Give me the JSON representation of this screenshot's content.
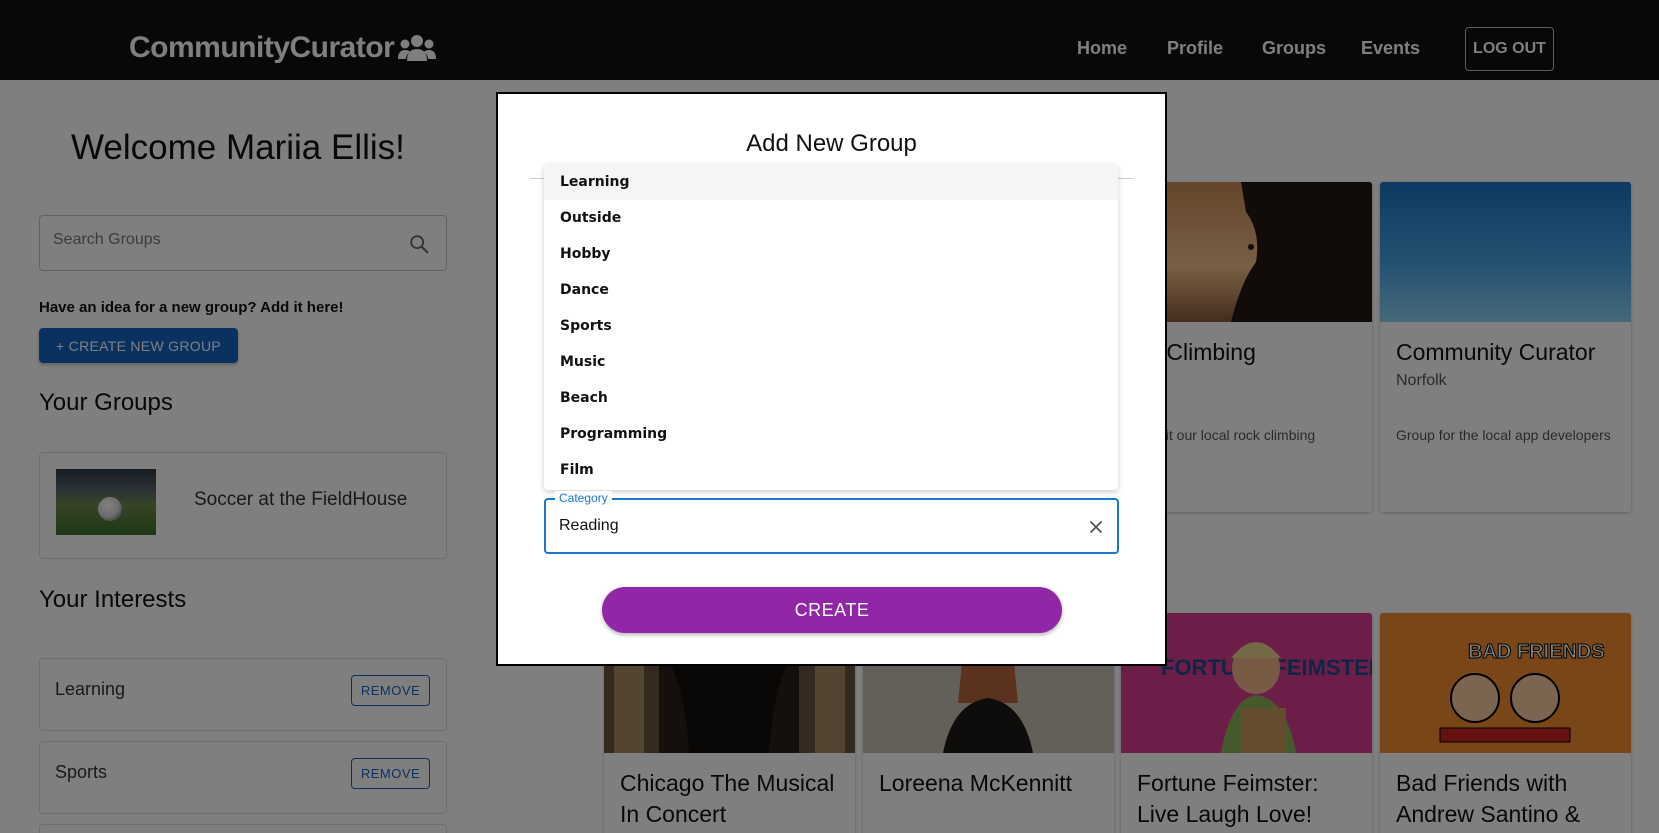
{
  "navbar": {
    "brand": "CommunityCurator",
    "links": [
      "Home",
      "Profile",
      "Groups",
      "Events"
    ],
    "logout_label": "LOG OUT"
  },
  "sidebar": {
    "welcome": "Welcome Mariia Ellis!",
    "search_placeholder": "Search Groups",
    "idea_text": "Have an idea for a new group? Add it here!",
    "create_button": "+ CREATE NEW GROUP",
    "your_groups_title": "Your Groups",
    "groups": [
      {
        "name": "Soccer at the FieldHouse"
      }
    ],
    "your_interests_title": "Your Interests",
    "interests": [
      {
        "name": "Learning",
        "action": "REMOVE"
      },
      {
        "name": "Sports",
        "action": "REMOVE"
      }
    ]
  },
  "main": {
    "top_cards": [
      {
        "title": "Rock Climbing",
        "visible_title": "ck Climbing",
        "location": "Norfolk",
        "visible_location": "folk",
        "description": "e visit our local rock climbing",
        "image_colors": [
          "#e3a56a",
          "#2a1d16"
        ]
      },
      {
        "title": "Community Curator",
        "location": "Norfolk",
        "description": "Group for the local app developers",
        "image_colors": [
          "#1f7bc7",
          "#8fd3f4"
        ]
      }
    ],
    "event_cards": [
      {
        "title": "Chicago The Musical In Concert",
        "image_colors": [
          "#8a6a4a",
          "#1a1410"
        ]
      },
      {
        "title": "Loreena McKennitt",
        "image_colors": [
          "#bdb4a6",
          "#2b2520"
        ]
      },
      {
        "title": "Fortune Feimster: Live Laugh Love!",
        "image_text": "FORTUNE FEIMSTER",
        "image_colors": [
          "#e0409a",
          "#1d4c8c"
        ]
      },
      {
        "title": "Bad Friends with Andrew Santino &",
        "image_text": "BAD FRIENDS",
        "image_colors": [
          "#f39a33",
          "#e06a1a"
        ]
      }
    ]
  },
  "modal": {
    "title": "Add New Group",
    "dropdown_options": [
      "Learning",
      "Outside",
      "Hobby",
      "Dance",
      "Sports",
      "Music",
      "Beach",
      "Programming",
      "Film"
    ],
    "highlighted_option": "Learning",
    "category_label": "Category",
    "category_value": "Reading",
    "create_label": "CREATE"
  }
}
